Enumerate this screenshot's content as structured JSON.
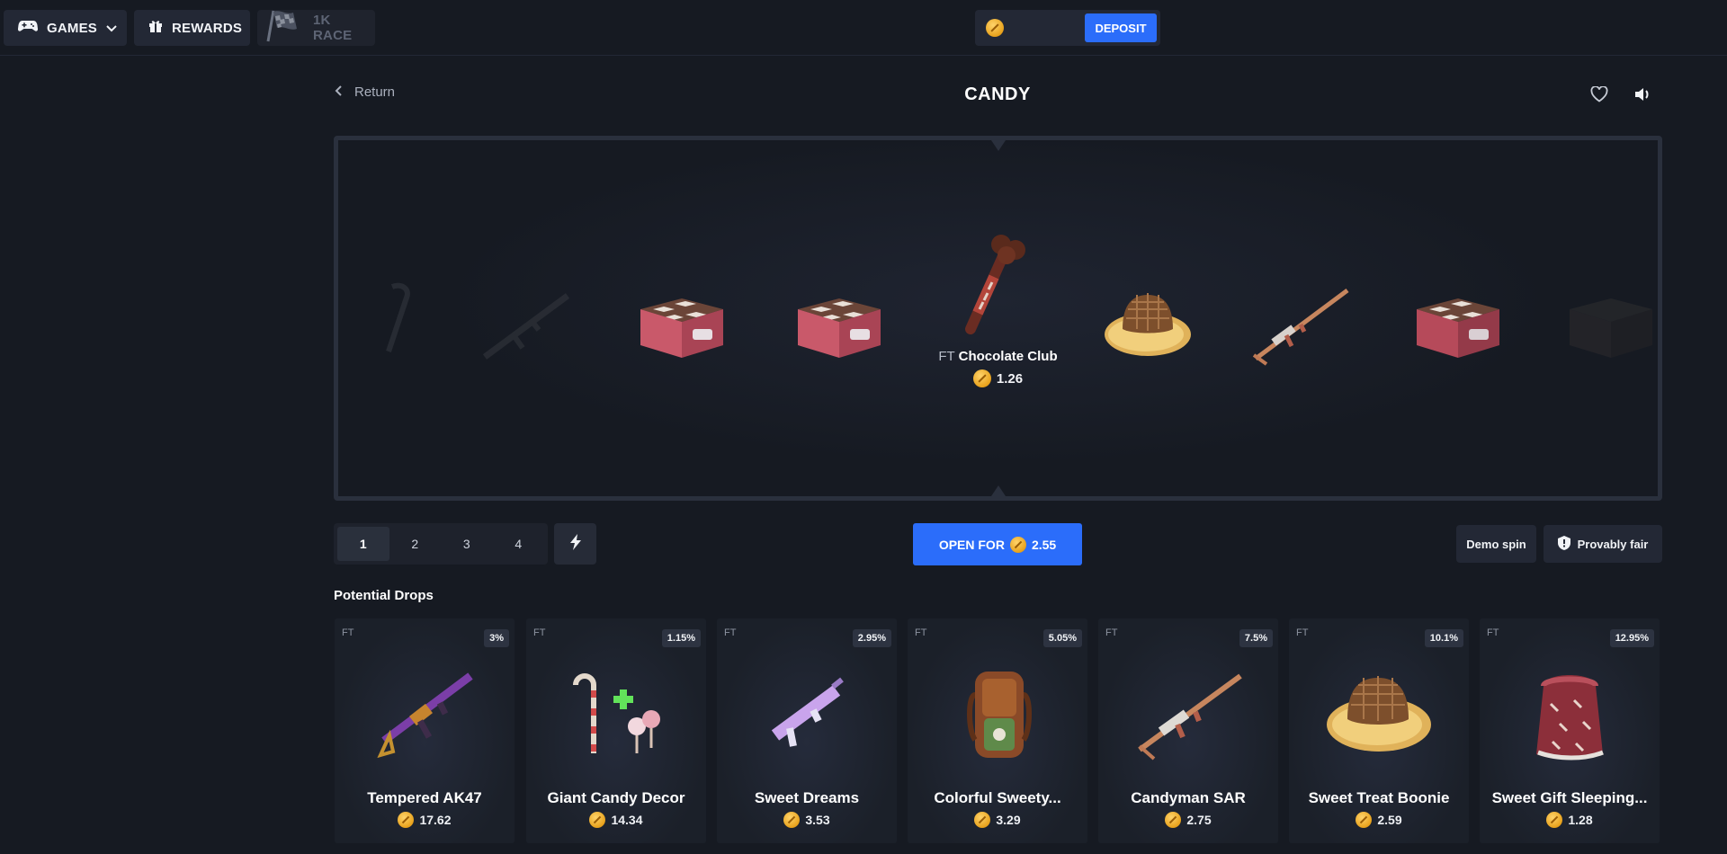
{
  "nav": {
    "games_label": "GAMES",
    "rewards_label": "REWARDS",
    "race_label": "1K RACE"
  },
  "wallet": {
    "deposit_label": "DEPOSIT"
  },
  "header": {
    "return_label": "Return",
    "title": "CANDY"
  },
  "spinner": {
    "center_condition": "FT",
    "center_name": "Chocolate Club",
    "center_price": "1.26",
    "reel_icons": [
      "faded-item-icon",
      "dark-rifle-icon",
      "candy-crate-icon",
      "candy-crate-icon",
      "chocolate-club-icon",
      "candy-boonie-hat-icon",
      "candy-rifle-icon",
      "candy-crate-icon",
      "dark-crate-icon"
    ]
  },
  "controls": {
    "quantities": [
      "1",
      "2",
      "3",
      "4"
    ],
    "selected_quantity": "1",
    "open_prefix": "OPEN FOR",
    "open_price": "2.55",
    "demo_label": "Demo spin",
    "fair_label": "Provably fair"
  },
  "drops": {
    "title": "Potential Drops",
    "items": [
      {
        "condition": "FT",
        "odds": "3%",
        "name": "Tempered AK47",
        "price": "17.62",
        "icon": "tempered-ak47-icon"
      },
      {
        "condition": "FT",
        "odds": "1.15%",
        "name": "Giant Candy Decor",
        "price": "14.34",
        "icon": "giant-candy-decor-icon"
      },
      {
        "condition": "FT",
        "odds": "2.95%",
        "name": "Sweet Dreams",
        "price": "3.53",
        "icon": "sweet-dreams-smg-icon"
      },
      {
        "condition": "FT",
        "odds": "5.05%",
        "name": "Colorful Sweety...",
        "price": "3.29",
        "icon": "colorful-backpack-icon"
      },
      {
        "condition": "FT",
        "odds": "7.5%",
        "name": "Candyman SAR",
        "price": "2.75",
        "icon": "candyman-sar-icon"
      },
      {
        "condition": "FT",
        "odds": "10.1%",
        "name": "Sweet Treat Boonie",
        "price": "2.59",
        "icon": "boonie-hat-icon"
      },
      {
        "condition": "FT",
        "odds": "12.95%",
        "name": "Sweet Gift Sleeping...",
        "price": "1.28",
        "icon": "sleeping-bag-icon"
      }
    ]
  },
  "colors": {
    "accent": "#2b6dfa",
    "background": "#161a22",
    "panel": "#232835"
  }
}
